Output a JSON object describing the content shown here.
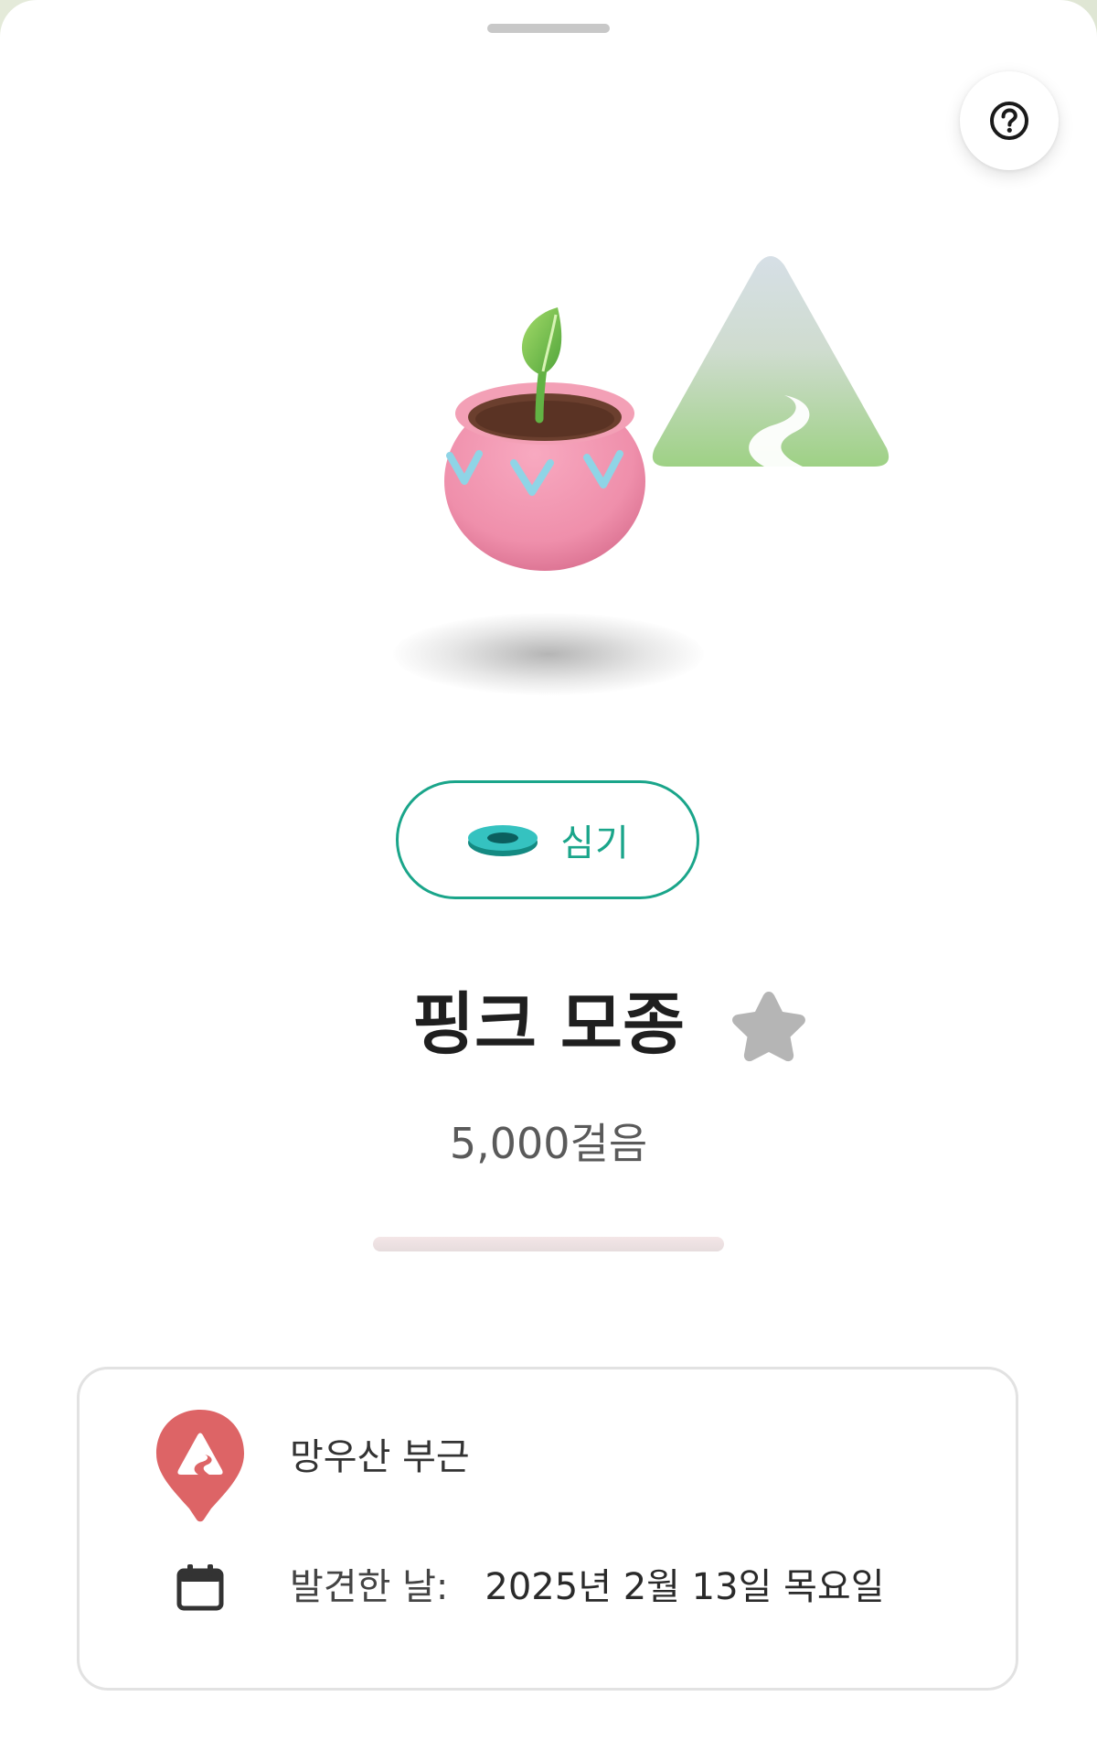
{
  "sheet": {
    "help_icon": "question-circle-icon"
  },
  "item": {
    "plant_button_label": "심기",
    "plant_button_icon": "planting-ring-icon",
    "name": "핑크 모종",
    "favorite_icon": "star-icon",
    "steps_label": "5,000걸음",
    "progress_fraction": 0.0
  },
  "details": {
    "location_icon": "mountain-location-pin-icon",
    "location": "망우산 부근",
    "calendar_icon": "calendar-icon",
    "found_label": "발견한 날:",
    "found_date": "2025년 2월 13일 목요일"
  },
  "colors": {
    "accent": "#1aa58a",
    "pin": "#dd6466",
    "star": "#b5b5b5",
    "progress_track": "#ece0e1"
  }
}
